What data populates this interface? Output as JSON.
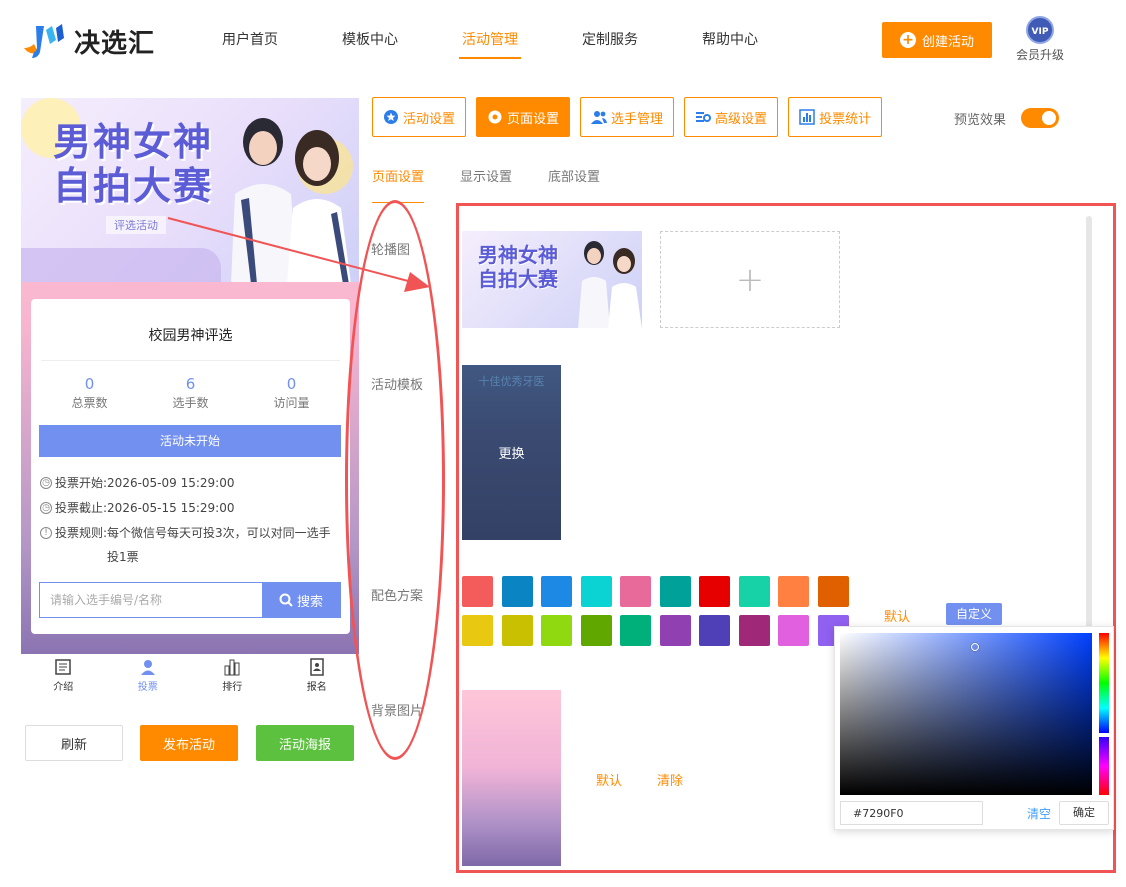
{
  "header": {
    "logo_text": "决选汇",
    "nav": [
      {
        "label": "用户首页"
      },
      {
        "label": "模板中心"
      },
      {
        "label": "活动管理",
        "active": true
      },
      {
        "label": "定制服务"
      },
      {
        "label": "帮助中心"
      }
    ],
    "create_button": "创建活动",
    "vip_badge": "VIP",
    "vip_label": "会员升级"
  },
  "preview": {
    "banner_title_line1": "男神女神",
    "banner_title_line2": "自拍大赛",
    "banner_subtitle": "评选活动",
    "card_title": "校园男神评选",
    "stats": [
      {
        "value": "0",
        "label": "总票数"
      },
      {
        "value": "6",
        "label": "选手数"
      },
      {
        "value": "0",
        "label": "访问量"
      }
    ],
    "status": "活动未开始",
    "vote_start_label": "投票开始:",
    "vote_start": "2026-05-09 15:29:00",
    "vote_end_label": "投票截止:",
    "vote_end": "2026-05-15 15:29:00",
    "vote_rule_label": "投票规则:",
    "vote_rule": "每个微信号每天可投3次，可以对同一选手投1票",
    "search_placeholder": "请输入选手编号/名称",
    "search_button": "搜索",
    "tabs": [
      {
        "label": "介绍",
        "icon": "document-icon"
      },
      {
        "label": "投票",
        "icon": "user-icon",
        "active": true
      },
      {
        "label": "排行",
        "icon": "bar-chart-icon"
      },
      {
        "label": "报名",
        "icon": "signup-icon"
      }
    ]
  },
  "actions": {
    "refresh": "刷新",
    "publish": "发布活动",
    "poster": "活动海报"
  },
  "toolbar": {
    "buttons": [
      {
        "label": "活动设置",
        "icon": "star-badge-icon"
      },
      {
        "label": "页面设置",
        "icon": "gear-icon",
        "active": true
      },
      {
        "label": "选手管理",
        "icon": "users-icon"
      },
      {
        "label": "高级设置",
        "icon": "advanced-settings-icon"
      },
      {
        "label": "投票统计",
        "icon": "bar-chart-icon"
      }
    ],
    "preview_label": "预览效果",
    "preview_on": true
  },
  "subtabs": [
    {
      "label": "页面设置",
      "active": true
    },
    {
      "label": "显示设置"
    },
    {
      "label": "底部设置"
    }
  ],
  "settings": {
    "carousel_label": "轮播图",
    "carousel_banner_line1": "男神女神",
    "carousel_banner_line2": "自拍大赛",
    "template_label": "活动模板",
    "template_title": "十佳优秀牙医",
    "template_swap": "更换",
    "color_label": "配色方案",
    "colors": [
      "#f45b5b",
      "#0a84c2",
      "#1e88e5",
      "#0cd3d3",
      "#e86a9a",
      "#00a199",
      "#e60000",
      "#17d2a6",
      "#ff8040",
      "#e06000",
      "#e8c810",
      "#c8c000",
      "#90d810",
      "#60a800",
      "#00b07a",
      "#9040b0",
      "#5040b8",
      "#a02878",
      "#e060e0",
      "#9060f0"
    ],
    "color_default": "默认",
    "color_custom": "自定义",
    "bg_label": "背景图片",
    "bg_default": "默认",
    "bg_clear": "清除"
  },
  "picker": {
    "hex_value": "#7290F0",
    "clear": "清空",
    "ok": "确定"
  },
  "colors": {
    "accent": "#ff8a00",
    "theme": "#7290f0",
    "green": "#5cc13f",
    "highlight": "#f05454"
  }
}
